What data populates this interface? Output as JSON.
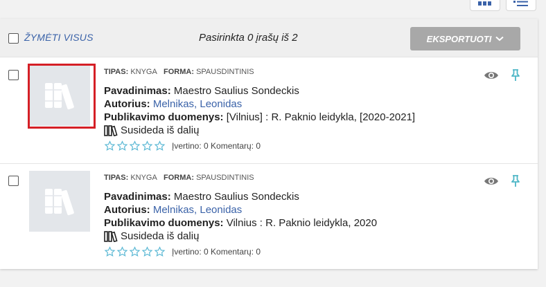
{
  "toolbar": {
    "select_all_label": "ŽYMĖTI VISUS",
    "selected_count": "Pasirinkta 0 įrašų iš 2",
    "export_label": "EKSPORTUOTI"
  },
  "icons": [
    "grid-view-icon",
    "list-view-icon",
    "chevron-down-icon",
    "book-placeholder-icon",
    "books-icon",
    "star-outline-icon",
    "eye-icon",
    "pin-icon"
  ],
  "colors": {
    "accent": "#3a62a8",
    "highlight": "#d51f26",
    "star": "#5bb8d4",
    "pin": "#4db6c6"
  },
  "records": [
    {
      "type_label": "TIPAS:",
      "type_value": "KNYGA",
      "form_label": "FORMA:",
      "form_value": "SPAUSDINTINIS",
      "title_label": "Pavadinimas:",
      "title_value": "Maestro Saulius Sondeckis",
      "author_label": "Autorius:",
      "author_value": "Melnikas, Leonidas",
      "pub_label": "Publikavimo duomenys:",
      "pub_value": "[Vilnius] : R. Paknio leidykla, [2020-2021]",
      "parts_label": "Susideda iš dalių",
      "rating_text": "Įvertino: 0 Komentarų: 0"
    },
    {
      "type_label": "TIPAS:",
      "type_value": "KNYGA",
      "form_label": "FORMA:",
      "form_value": "SPAUSDINTINIS",
      "title_label": "Pavadinimas:",
      "title_value": "Maestro Saulius Sondeckis",
      "author_label": "Autorius:",
      "author_value": "Melnikas, Leonidas",
      "pub_label": "Publikavimo duomenys:",
      "pub_value": "Vilnius : R. Paknio leidykla, 2020",
      "parts_label": "Susideda iš dalių",
      "rating_text": "Įvertino: 0 Komentarų: 0"
    }
  ]
}
